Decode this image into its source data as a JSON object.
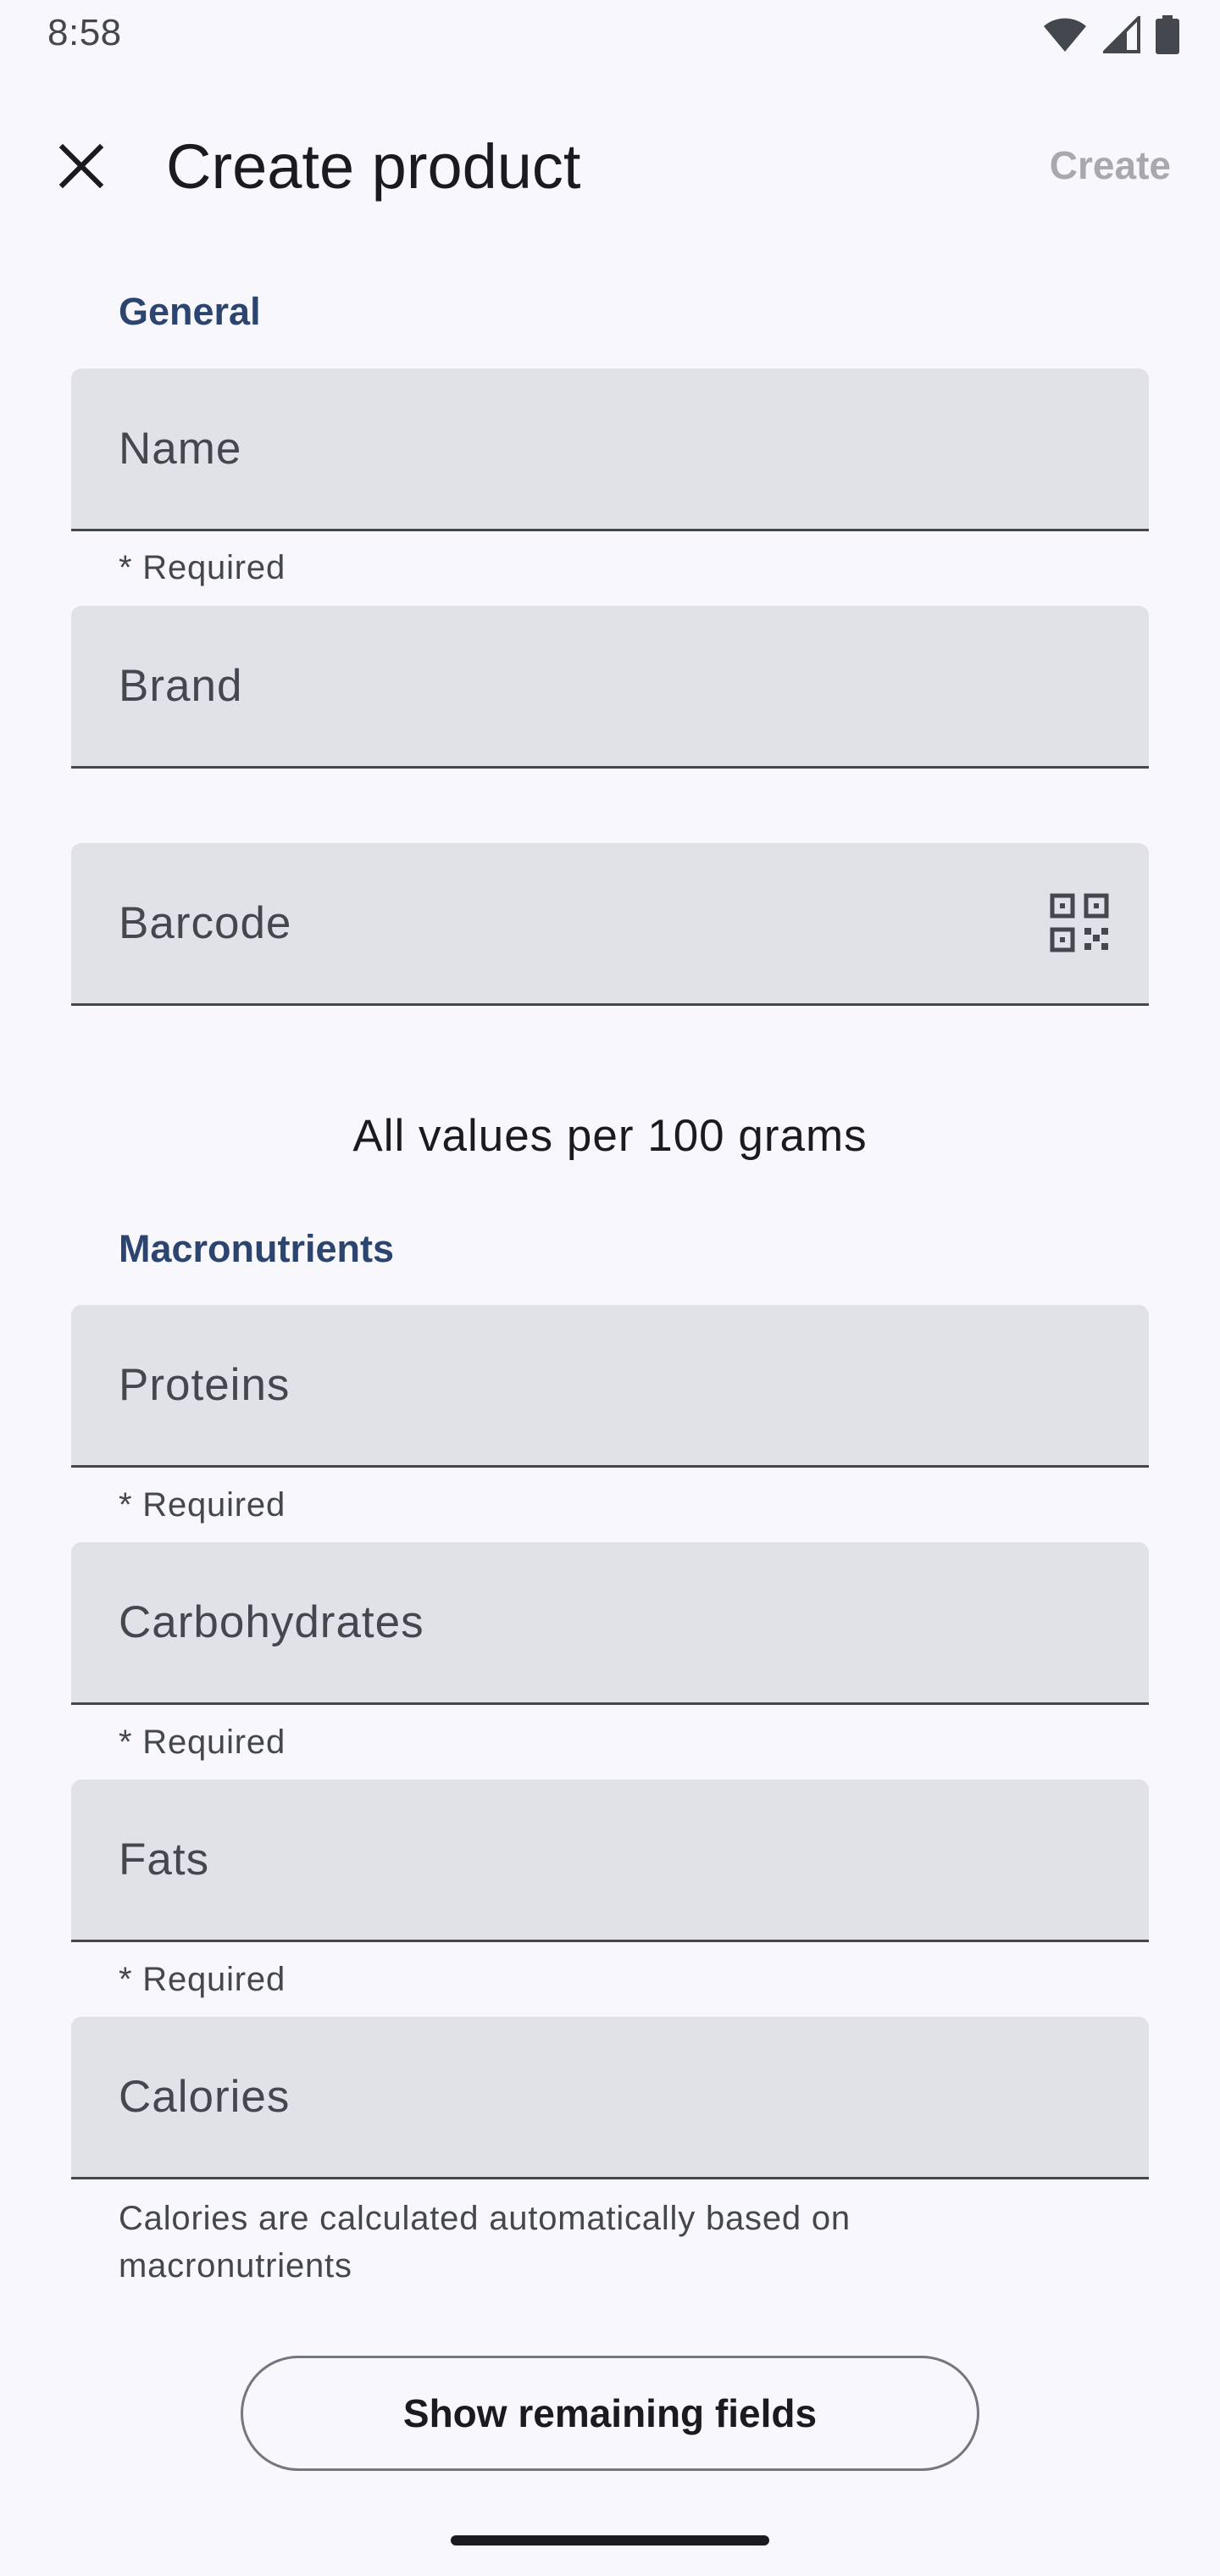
{
  "status_bar": {
    "time": "8:58",
    "icons": [
      "wifi-icon",
      "cellular-signal-icon",
      "battery-icon"
    ]
  },
  "top_bar": {
    "close_icon": "close-icon",
    "title": "Create product",
    "create_label": "Create"
  },
  "general": {
    "header": "General",
    "name": {
      "label": "Name",
      "helper": "* Required"
    },
    "brand": {
      "label": "Brand"
    },
    "barcode": {
      "label": "Barcode",
      "trailing_icon": "qr-code-scanner-icon"
    }
  },
  "per_note": "All values per 100 grams",
  "macronutrients": {
    "header": "Macronutrients",
    "proteins": {
      "label": "Proteins",
      "helper": "* Required"
    },
    "carbohydrates": {
      "label": "Carbohydrates",
      "helper": "* Required"
    },
    "fats": {
      "label": "Fats",
      "helper": "* Required"
    },
    "calories": {
      "label": "Calories",
      "helper": "Calories are calculated automatically based on macronutrients"
    }
  },
  "show_remaining_label": "Show remaining fields",
  "colors": {
    "background": "#f8f7fc",
    "field_fill": "#e1e2e8",
    "section_header": "#2c4470",
    "disabled_text": "#a9a9ad",
    "outline": "#74777f"
  }
}
